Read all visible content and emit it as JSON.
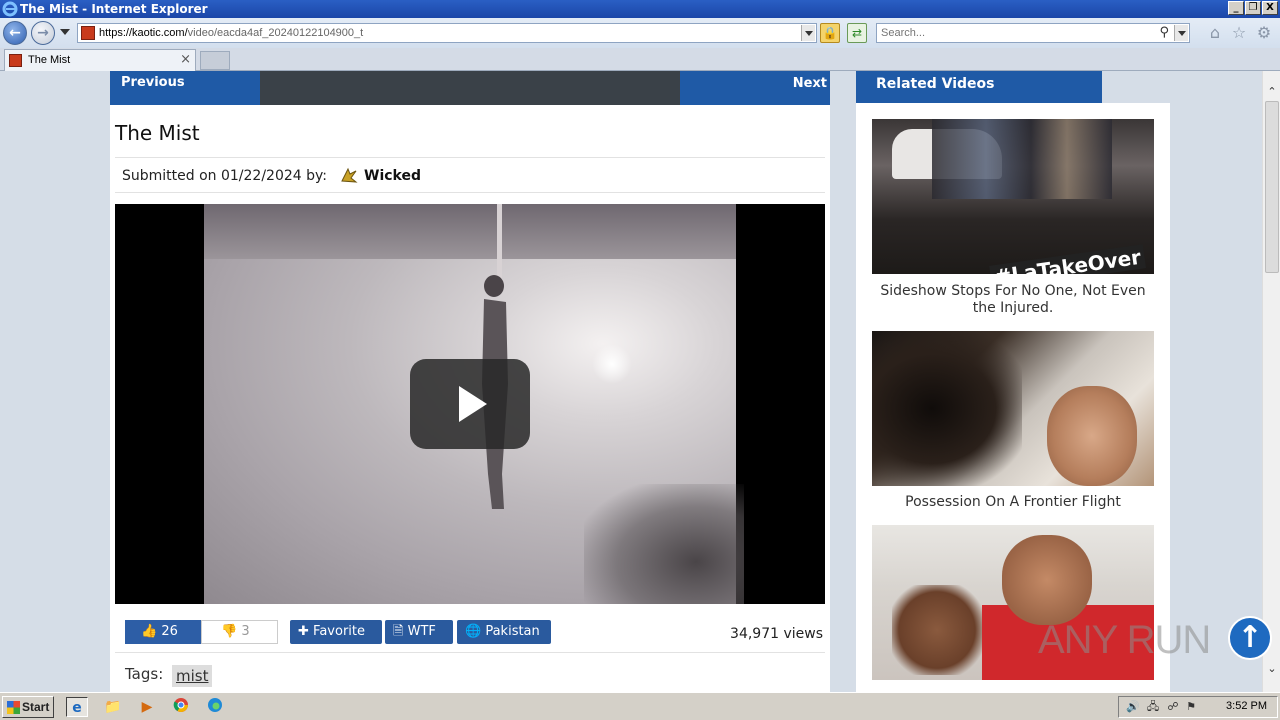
{
  "window": {
    "title": "The Mist - Internet Explorer",
    "controls": {
      "minimize": "_",
      "maximize": "❐",
      "close": "X"
    }
  },
  "addressbar": {
    "url_host": "https://kaotic.com/",
    "url_path": "video/eacda4af_20240122104900_t",
    "search_placeholder": "Search..."
  },
  "tabs": [
    {
      "label": "The Mist",
      "close": "×"
    }
  ],
  "nav": {
    "previous_label": "Previous",
    "next_label": "Next"
  },
  "video": {
    "title": "The Mist",
    "submitted_prefix": "Submitted on 01/22/2024 by:",
    "submitted_user": "Wicked",
    "likes": "26",
    "dislikes": "3",
    "favorite_label": "Favorite",
    "wtf_label": "WTF",
    "country_label": "Pakistan",
    "views": "34,971 views",
    "tags_label": "Tags:",
    "tags": [
      "mist"
    ]
  },
  "sidebar": {
    "heading": "Related Videos",
    "items": [
      {
        "caption": "Sideshow Stops For No One, Not Even the Injured.",
        "overlay_text": "#LaTakeOver"
      },
      {
        "caption": "Possession On A Frontier Flight"
      },
      {
        "caption": ""
      }
    ]
  },
  "watermark": {
    "text": "ANY RUN"
  },
  "taskbar": {
    "start_label": "Start",
    "clock": "3:52 PM"
  }
}
